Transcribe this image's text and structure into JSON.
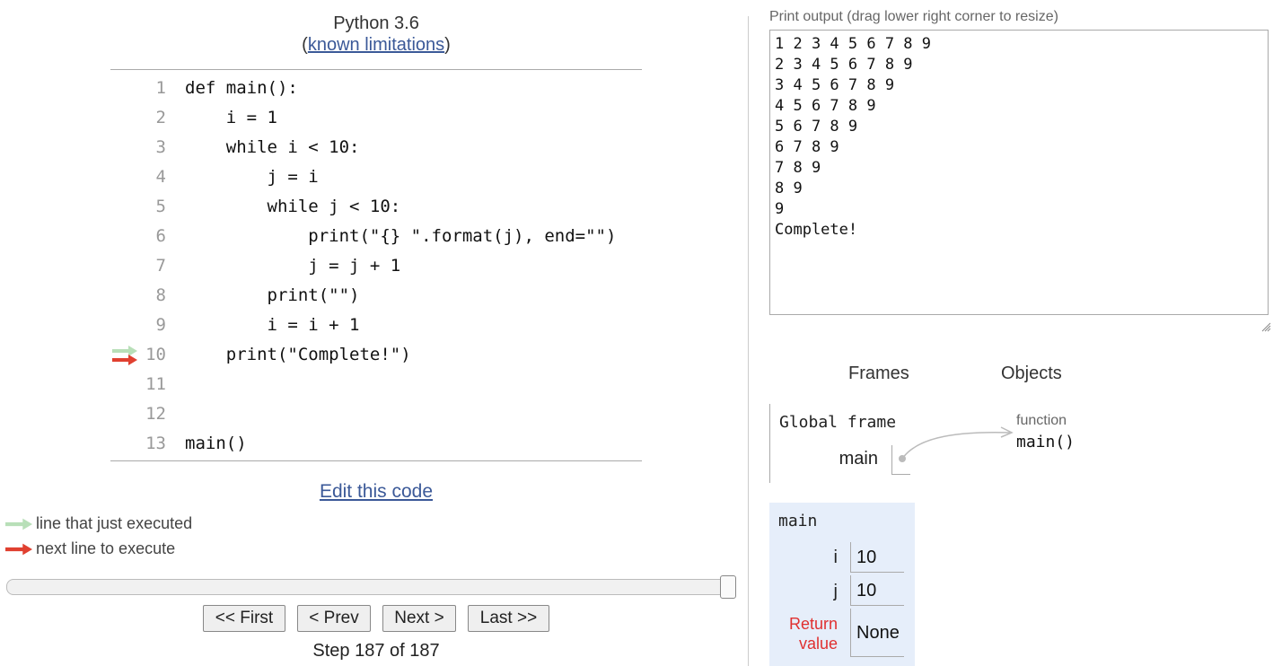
{
  "header": {
    "language": "Python 3.6",
    "limitations_open": "(",
    "limitations_link": "known limitations",
    "limitations_close": ")"
  },
  "code": {
    "lines": [
      {
        "num": "1",
        "text": "def main():"
      },
      {
        "num": "2",
        "text": "    i = 1"
      },
      {
        "num": "3",
        "text": "    while i < 10:"
      },
      {
        "num": "4",
        "text": "        j = i"
      },
      {
        "num": "5",
        "text": "        while j < 10:"
      },
      {
        "num": "6",
        "text": "            print(\"{} \".format(j), end=\"\")"
      },
      {
        "num": "7",
        "text": "            j = j + 1"
      },
      {
        "num": "8",
        "text": "        print(\"\")"
      },
      {
        "num": "9",
        "text": "        i = i + 1"
      },
      {
        "num": "10",
        "text": "    print(\"Complete!\")"
      },
      {
        "num": "11",
        "text": ""
      },
      {
        "num": "12",
        "text": ""
      },
      {
        "num": "13",
        "text": "main()"
      }
    ],
    "current_line": 10
  },
  "edit_link": "Edit this code",
  "legend": {
    "executed": "line that just executed",
    "next": "next line to execute"
  },
  "nav": {
    "first": "<< First",
    "prev": "< Prev",
    "next": "Next >",
    "last": "Last >>",
    "step_text": "Step 187 of 187",
    "progress": 1.0
  },
  "output": {
    "label": "Print output (drag lower right corner to resize)",
    "text": "1 2 3 4 5 6 7 8 9\n2 3 4 5 6 7 8 9\n3 4 5 6 7 8 9\n4 5 6 7 8 9\n5 6 7 8 9\n6 7 8 9\n7 8 9\n8 9\n9\nComplete!"
  },
  "viz": {
    "frames_header": "Frames",
    "objects_header": "Objects",
    "global_frame_label": "Global frame",
    "global_var": "main",
    "function_type": "function",
    "function_name": "main()",
    "main_frame": {
      "title": "main",
      "vars": [
        {
          "name": "i",
          "value": "10"
        },
        {
          "name": "j",
          "value": "10"
        }
      ],
      "return_label_1": "Return",
      "return_label_2": "value",
      "return_value": "None"
    }
  },
  "colors": {
    "executed_arrow": "#b8dfb8",
    "next_arrow": "#e04030",
    "link": "#3b5998",
    "return_label": "#e03030",
    "frame_bg": "#e6eefa"
  }
}
